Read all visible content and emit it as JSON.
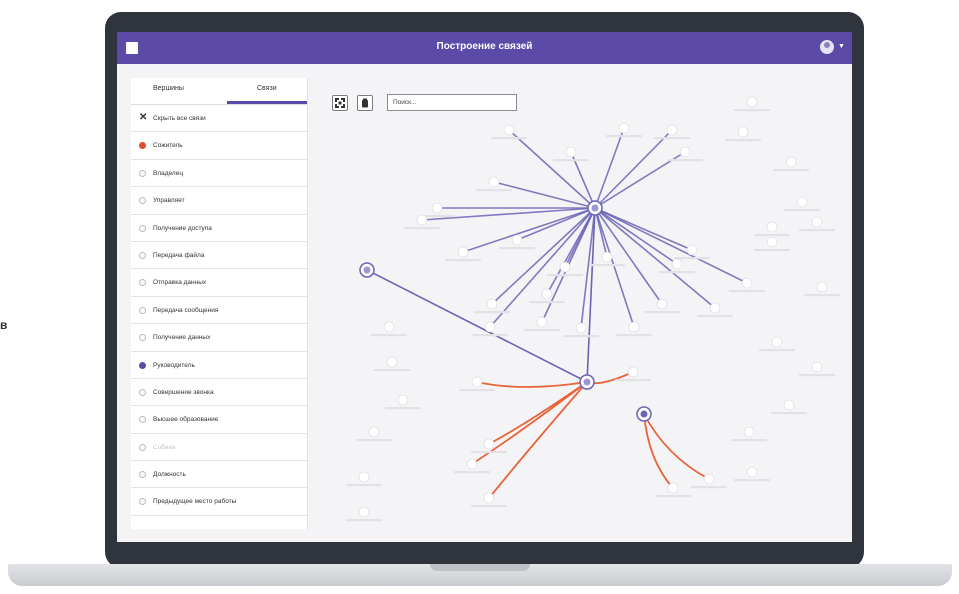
{
  "stray_text": "в",
  "app": {
    "title": "Построение связей"
  },
  "sidebar": {
    "tabs": [
      {
        "label": "Вершины",
        "active": false
      },
      {
        "label": "Связи",
        "active": true
      }
    ],
    "items": [
      {
        "label": "Скрыть все связи",
        "icon": "close-icon",
        "state": "none"
      },
      {
        "label": "Сожитель",
        "icon": "radio",
        "state": "red"
      },
      {
        "label": "Владелец",
        "icon": "radio",
        "state": "off"
      },
      {
        "label": "Управляет",
        "icon": "radio",
        "state": "off"
      },
      {
        "label": "Получение доступа",
        "icon": "radio",
        "state": "off"
      },
      {
        "label": "Передача файла",
        "icon": "radio",
        "state": "off"
      },
      {
        "label": "Отправка данных",
        "icon": "radio",
        "state": "off"
      },
      {
        "label": "Передача сообщения",
        "icon": "radio",
        "state": "off"
      },
      {
        "label": "Получение данных",
        "icon": "radio",
        "state": "off"
      },
      {
        "label": "Руководитель",
        "icon": "radio",
        "state": "purple"
      },
      {
        "label": "Совершение звонка",
        "icon": "radio",
        "state": "off"
      },
      {
        "label": "Высшее образование",
        "icon": "radio",
        "state": "off"
      },
      {
        "label": "Собака",
        "icon": "radio",
        "state": "faded"
      },
      {
        "label": "Должность",
        "icon": "radio",
        "state": "off"
      },
      {
        "label": "Предыдущее место работы",
        "icon": "radio",
        "state": "off"
      }
    ]
  },
  "toolbar": {
    "buttons": [
      "fit-to-screen-icon",
      "delete-icon"
    ],
    "search_placeholder": "Поиск..."
  },
  "colors": {
    "accent": "#5b4aa8",
    "edge_purple": "#6b63b5",
    "edge_orange": "#e8643a",
    "node_red": "#e24b2a"
  }
}
